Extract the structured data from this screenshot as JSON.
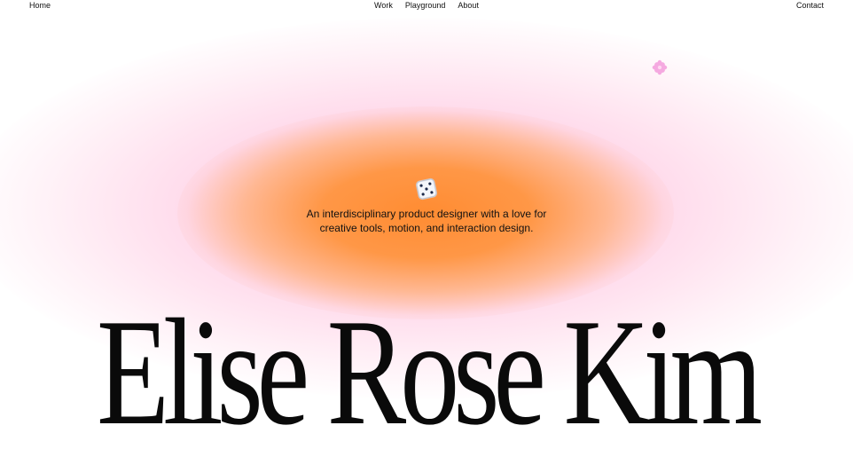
{
  "nav": {
    "home": "Home",
    "center_links": [
      "Work",
      "Playground",
      "About"
    ],
    "contact": "Contact"
  },
  "hero": {
    "tagline_line1": "An interdisciplinary product designer with a love for",
    "tagline_line2": "creative tools, motion, and interaction design.",
    "name": "Elise Rose Kim"
  },
  "icons": {
    "flower": "flower-icon",
    "dice": "dice-icon"
  },
  "colors": {
    "glow_orange": "#ff8c32",
    "glow_pink": "#ffc8e1",
    "flower_pink": "#f5a9e0",
    "text": "#111111",
    "background": "#ffffff"
  }
}
